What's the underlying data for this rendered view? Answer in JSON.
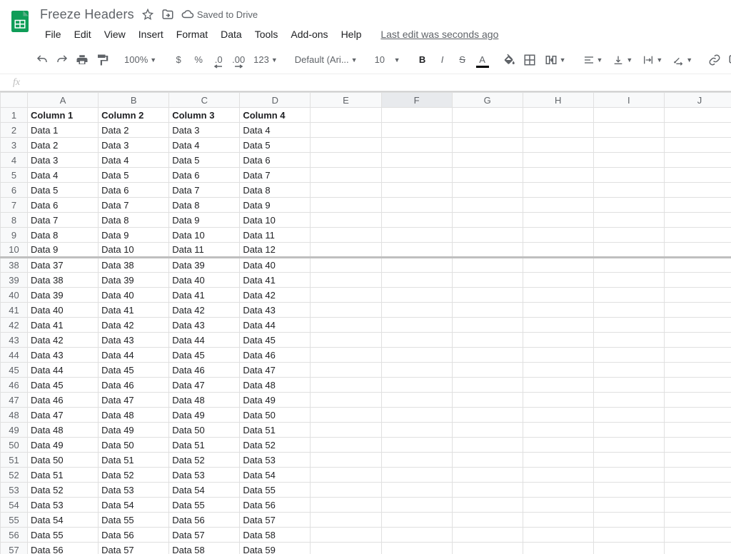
{
  "doc": {
    "title": "Freeze Headers",
    "saved_text": "Saved to Drive",
    "last_edit": "Last edit was seconds ago"
  },
  "menus": {
    "file": "File",
    "edit": "Edit",
    "view": "View",
    "insert": "Insert",
    "format": "Format",
    "data": "Data",
    "tools": "Tools",
    "addons": "Add-ons",
    "help": "Help"
  },
  "toolbar": {
    "zoom": "100%",
    "currency": "$",
    "percent": "%",
    "dec_dec": ".0",
    "inc_dec": ".00",
    "more_fmt": "123",
    "font": "Default (Ari...",
    "size": "10",
    "bold": "B",
    "italic": "I",
    "strike": "S",
    "textcolor": "A"
  },
  "formula": {
    "label": "fx",
    "value": ""
  },
  "columns": [
    "A",
    "B",
    "C",
    "D",
    "E",
    "F",
    "G",
    "H",
    "I",
    "J"
  ],
  "selected_col_index": 5,
  "header_row": {
    "num": "1",
    "cells": [
      "Column 1",
      "Column 2",
      "Column 3",
      "Column 4",
      "",
      "",
      "",
      "",
      "",
      ""
    ]
  },
  "rows": [
    {
      "num": "2",
      "cells": [
        "Data 1",
        "Data 2",
        "Data 3",
        "Data 4",
        "",
        "",
        "",
        "",
        "",
        ""
      ]
    },
    {
      "num": "3",
      "cells": [
        "Data 2",
        "Data 3",
        "Data 4",
        "Data 5",
        "",
        "",
        "",
        "",
        "",
        ""
      ]
    },
    {
      "num": "4",
      "cells": [
        "Data 3",
        "Data 4",
        "Data 5",
        "Data 6",
        "",
        "",
        "",
        "",
        "",
        ""
      ]
    },
    {
      "num": "5",
      "cells": [
        "Data 4",
        "Data 5",
        "Data 6",
        "Data 7",
        "",
        "",
        "",
        "",
        "",
        ""
      ]
    },
    {
      "num": "6",
      "cells": [
        "Data 5",
        "Data 6",
        "Data 7",
        "Data 8",
        "",
        "",
        "",
        "",
        "",
        ""
      ]
    },
    {
      "num": "7",
      "cells": [
        "Data 6",
        "Data 7",
        "Data 8",
        "Data 9",
        "",
        "",
        "",
        "",
        "",
        ""
      ]
    },
    {
      "num": "8",
      "cells": [
        "Data 7",
        "Data 8",
        "Data 9",
        "Data 10",
        "",
        "",
        "",
        "",
        "",
        ""
      ]
    },
    {
      "num": "9",
      "cells": [
        "Data 8",
        "Data 9",
        "Data 10",
        "Data 11",
        "",
        "",
        "",
        "",
        "",
        ""
      ]
    },
    {
      "num": "10",
      "cells": [
        "Data 9",
        "Data 10",
        "Data 11",
        "Data 12",
        "",
        "",
        "",
        "",
        "",
        ""
      ],
      "freeze_after": true
    },
    {
      "num": "38",
      "cells": [
        "Data 37",
        "Data 38",
        "Data 39",
        "Data 40",
        "",
        "",
        "",
        "",
        "",
        ""
      ]
    },
    {
      "num": "39",
      "cells": [
        "Data 38",
        "Data 39",
        "Data 40",
        "Data 41",
        "",
        "",
        "",
        "",
        "",
        ""
      ]
    },
    {
      "num": "40",
      "cells": [
        "Data 39",
        "Data 40",
        "Data 41",
        "Data 42",
        "",
        "",
        "",
        "",
        "",
        ""
      ]
    },
    {
      "num": "41",
      "cells": [
        "Data 40",
        "Data 41",
        "Data 42",
        "Data 43",
        "",
        "",
        "",
        "",
        "",
        ""
      ]
    },
    {
      "num": "42",
      "cells": [
        "Data 41",
        "Data 42",
        "Data 43",
        "Data 44",
        "",
        "",
        "",
        "",
        "",
        ""
      ]
    },
    {
      "num": "43",
      "cells": [
        "Data 42",
        "Data 43",
        "Data 44",
        "Data 45",
        "",
        "",
        "",
        "",
        "",
        ""
      ]
    },
    {
      "num": "44",
      "cells": [
        "Data 43",
        "Data 44",
        "Data 45",
        "Data 46",
        "",
        "",
        "",
        "",
        "",
        ""
      ]
    },
    {
      "num": "45",
      "cells": [
        "Data 44",
        "Data 45",
        "Data 46",
        "Data 47",
        "",
        "",
        "",
        "",
        "",
        ""
      ]
    },
    {
      "num": "46",
      "cells": [
        "Data 45",
        "Data 46",
        "Data 47",
        "Data 48",
        "",
        "",
        "",
        "",
        "",
        ""
      ]
    },
    {
      "num": "47",
      "cells": [
        "Data 46",
        "Data 47",
        "Data 48",
        "Data 49",
        "",
        "",
        "",
        "",
        "",
        ""
      ]
    },
    {
      "num": "48",
      "cells": [
        "Data 47",
        "Data 48",
        "Data 49",
        "Data 50",
        "",
        "",
        "",
        "",
        "",
        ""
      ]
    },
    {
      "num": "49",
      "cells": [
        "Data 48",
        "Data 49",
        "Data 50",
        "Data 51",
        "",
        "",
        "",
        "",
        "",
        ""
      ]
    },
    {
      "num": "50",
      "cells": [
        "Data 49",
        "Data 50",
        "Data 51",
        "Data 52",
        "",
        "",
        "",
        "",
        "",
        ""
      ]
    },
    {
      "num": "51",
      "cells": [
        "Data 50",
        "Data 51",
        "Data 52",
        "Data 53",
        "",
        "",
        "",
        "",
        "",
        ""
      ]
    },
    {
      "num": "52",
      "cells": [
        "Data 51",
        "Data 52",
        "Data 53",
        "Data 54",
        "",
        "",
        "",
        "",
        "",
        ""
      ]
    },
    {
      "num": "53",
      "cells": [
        "Data 52",
        "Data 53",
        "Data 54",
        "Data 55",
        "",
        "",
        "",
        "",
        "",
        ""
      ]
    },
    {
      "num": "54",
      "cells": [
        "Data 53",
        "Data 54",
        "Data 55",
        "Data 56",
        "",
        "",
        "",
        "",
        "",
        ""
      ]
    },
    {
      "num": "55",
      "cells": [
        "Data 54",
        "Data 55",
        "Data 56",
        "Data 57",
        "",
        "",
        "",
        "",
        "",
        ""
      ]
    },
    {
      "num": "56",
      "cells": [
        "Data 55",
        "Data 56",
        "Data 57",
        "Data 58",
        "",
        "",
        "",
        "",
        "",
        ""
      ]
    },
    {
      "num": "57",
      "cells": [
        "Data 56",
        "Data 57",
        "Data 58",
        "Data 59",
        "",
        "",
        "",
        "",
        "",
        ""
      ]
    }
  ]
}
